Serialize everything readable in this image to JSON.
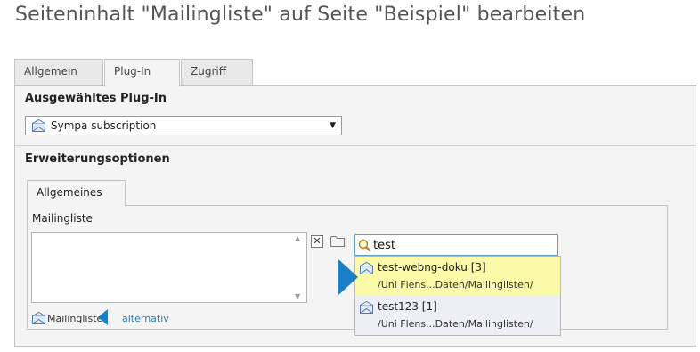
{
  "page": {
    "title": "Seiteninhalt \"Mailingliste\" auf Seite \"Beispiel\" bearbeiten"
  },
  "tabs": [
    {
      "label": "Allgemein",
      "active": false
    },
    {
      "label": "Plug-In",
      "active": true
    },
    {
      "label": "Zugriff",
      "active": false
    }
  ],
  "plugin_section": {
    "title": "Ausgewähltes Plug-In",
    "select": {
      "value": "Sympa subscription",
      "arrow": "▼"
    }
  },
  "options_section": {
    "title": "Erweiterungsoptionen",
    "inner_tab": "Allgemeines",
    "field_label": "Mailingliste",
    "remove_symbol": "✕",
    "link": "Mailingliste",
    "alt_link": "alternativ"
  },
  "search": {
    "value": "test",
    "results": [
      {
        "title": "test-webng-doku [3]",
        "path": "/Uni Flens...Daten/Mailinglisten/",
        "highlighted": true
      },
      {
        "title": "test123 [1]",
        "path": "/Uni Flens...Daten/Mailinglisten/",
        "highlighted": false
      }
    ]
  },
  "colors": {
    "accent": "#1a7fc4",
    "highlight": "#fafaa8",
    "panel": "#f4f4f4",
    "border": "#c3c3c3"
  },
  "icons": [
    "mailinglist-icon",
    "folder-icon",
    "search-icon",
    "remove-icon",
    "pointer-arrow-icon"
  ]
}
